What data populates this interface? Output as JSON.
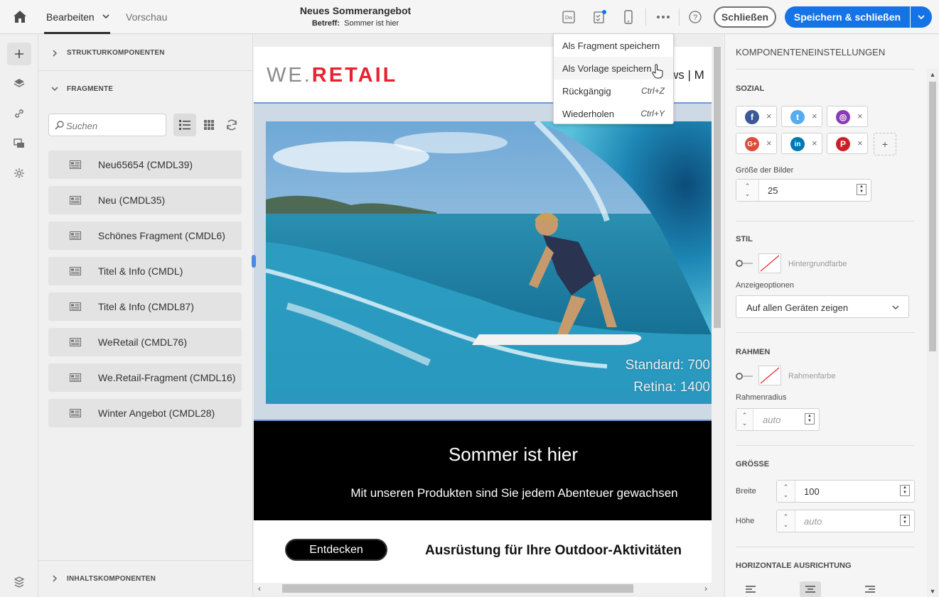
{
  "topbar": {
    "tab_edit": "Bearbeiten",
    "tab_preview": "Vorschau",
    "doc_title": "Neues Sommerangebot",
    "subject_label": "Betreff:",
    "subject_value": "Sommer ist hier",
    "dw_label": "Dw",
    "close_label": "Schließen",
    "save_close_label": "Speichern & schließen",
    "help_label": "?",
    "accent": "#1473e6"
  },
  "more_menu": {
    "items": [
      {
        "label": "Als Fragment speichern",
        "shortcut": ""
      },
      {
        "label": "Als Vorlage speichern",
        "shortcut": ""
      },
      {
        "label": "Rückgängig",
        "shortcut": "Ctrl+Z"
      },
      {
        "label": "Wiederholen",
        "shortcut": "Ctrl+Y"
      }
    ]
  },
  "left_panel": {
    "sections": {
      "structure": "STRUKTURKOMPONENTEN",
      "fragments": "FRAGMENTE",
      "content": "INHALTSKOMPONENTEN"
    },
    "search_placeholder": "Suchen",
    "fragments": [
      "Neu65654 (CMDL39)",
      "Neu (CMDL35)",
      "Schönes Fragment (CMDL6)",
      "Titel & Info (CMDL)",
      "Titel & Info (CMDL87)",
      "WeRetail (CMDL76)",
      "We.Retail-Fragment (CMDL16)",
      "Winter Angebot (CMDL28)"
    ]
  },
  "canvas": {
    "logo_we": "WE.",
    "logo_retail": "RETAIL",
    "nav_text": "ws  |  M",
    "hero_caption_1": "Standard: 700",
    "hero_caption_2": "Retina: 1400",
    "headline": "Sommer ist hier",
    "subline": "Mit unseren Produkten sind Sie jedem Abenteuer gewachsen",
    "cta_label": "Entdecken",
    "cta_title": "Ausrüstung für Ihre Outdoor-Aktivitäten"
  },
  "right_panel": {
    "title": "KOMPONENTENEINSTELLUNGEN",
    "social": {
      "heading": "SOZIAL",
      "networks": [
        {
          "icon": "facebook-icon",
          "glyph": "f",
          "color": "#3b5998"
        },
        {
          "icon": "twitter-icon",
          "glyph": "t",
          "color": "#55acee"
        },
        {
          "icon": "instagram-icon",
          "glyph": "◎",
          "color": "#8a3ab9"
        },
        {
          "icon": "google-plus-icon",
          "glyph": "G+",
          "color": "#dd4b39"
        },
        {
          "icon": "linkedin-icon",
          "glyph": "in",
          "color": "#0077b5"
        },
        {
          "icon": "pinterest-icon",
          "glyph": "P",
          "color": "#cb2027"
        }
      ],
      "add_label": "+",
      "image_size_label": "Größe der Bilder",
      "image_size_value": "25"
    },
    "style": {
      "heading": "STIL",
      "bg_color_label": "Hintergrundfarbe",
      "display_options_label": "Anzeigeoptionen",
      "display_options_value": "Auf allen Geräten zeigen"
    },
    "border": {
      "heading": "RAHMEN",
      "border_color_label": "Rahmenfarbe",
      "radius_label": "Rahmenradius",
      "radius_placeholder": "auto"
    },
    "size": {
      "heading": "GRÖSSE",
      "width_label": "Breite",
      "width_value": "100",
      "height_label": "Höhe",
      "height_placeholder": "auto"
    },
    "alignment": {
      "heading": "HORIZONTALE AUSRICHTUNG"
    }
  }
}
